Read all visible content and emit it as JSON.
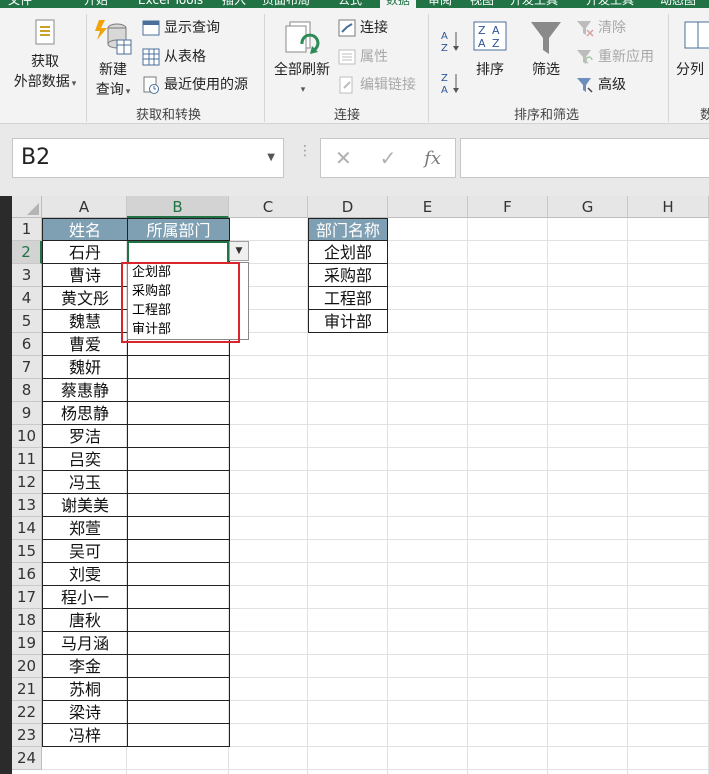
{
  "ribbon": {
    "tabs": [
      "文件",
      "开始",
      "Excel Tools",
      "插入",
      "页面布局",
      "公式",
      "数据",
      "审阅",
      "视图",
      "开发工具",
      "开发工具",
      "动态图"
    ],
    "active_tab_index": 6,
    "get_transform": {
      "get_external_label_1": "获取",
      "get_external_label_2": "外部数据",
      "new_query_label_1": "新建",
      "new_query_label_2": "查询",
      "show_queries": "显示查询",
      "from_table": "从表格",
      "recent_sources": "最近使用的源",
      "group_label": "获取和转换"
    },
    "connections": {
      "refresh_all": "全部刷新",
      "connections": "连接",
      "properties": "属性",
      "edit_links": "编辑链接",
      "group_label": "连接"
    },
    "sort_filter": {
      "sort": "排序",
      "filter": "筛选",
      "clear": "清除",
      "reapply": "重新应用",
      "advanced": "高级",
      "group_label": "排序和筛选"
    },
    "data_tools": {
      "text_to_columns": "分列",
      "group_label_partial": "数"
    }
  },
  "formula_bar": {
    "name_box": "B2",
    "cancel_glyph": "✕",
    "enter_glyph": "✓",
    "fx_glyph": "fx",
    "formula": ""
  },
  "grid": {
    "columns": [
      "A",
      "B",
      "C",
      "D",
      "E",
      "F",
      "G",
      "H"
    ],
    "selected_column": "B",
    "rows": [
      "1",
      "2",
      "3",
      "4",
      "5",
      "6",
      "7",
      "8",
      "9",
      "10",
      "11",
      "12",
      "13",
      "14",
      "15",
      "16",
      "17",
      "18",
      "19",
      "20",
      "21",
      "22",
      "23",
      "24"
    ],
    "selected_row": "2",
    "header_name": "姓名",
    "header_dept": "所属部门",
    "names": [
      "石丹",
      "曹诗",
      "黄文彤",
      "魏慧",
      "曹爱",
      "魏妍",
      "蔡惠静",
      "杨思静",
      "罗洁",
      "吕奕",
      "冯玉",
      "谢美美",
      "郑萱",
      "吴可",
      "刘雯",
      "程小一",
      "唐秋",
      "马月涵",
      "李金",
      "苏桐",
      "梁诗",
      "冯梓"
    ],
    "dept_list_header": "部门名称",
    "dept_list": [
      "企划部",
      "采购部",
      "工程部",
      "审计部"
    ]
  },
  "dropdown": {
    "items": [
      "企划部",
      "采购部",
      "工程部",
      "审计部"
    ]
  }
}
